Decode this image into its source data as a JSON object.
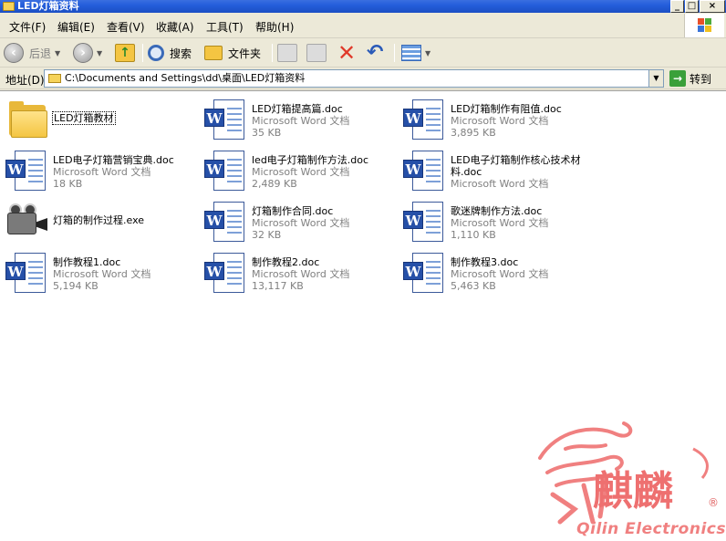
{
  "window": {
    "title": "LED灯箱资料",
    "controls": [
      "_",
      "□",
      "×"
    ]
  },
  "menu": [
    "文件(F)",
    "编辑(E)",
    "查看(V)",
    "收藏(A)",
    "工具(T)",
    "帮助(H)"
  ],
  "toolbar": {
    "back_label": "后退",
    "search_label": "搜索",
    "folders_label": "文件夹"
  },
  "address": {
    "label": "地址(D)",
    "path": "C:\\Documents and Settings\\dd\\桌面\\LED灯箱资料",
    "go_label": "转到"
  },
  "files": [
    {
      "name": "LED灯箱教材",
      "type": "",
      "size": "",
      "icon": "folder-icon"
    },
    {
      "name": "LED灯箱提高篇.doc",
      "type": "Microsoft Word 文档",
      "size": "35 KB",
      "icon": "word-doc-icon"
    },
    {
      "name": "LED灯箱制作有阻值.doc",
      "type": "Microsoft Word 文档",
      "size": "3,895 KB",
      "icon": "word-doc-icon"
    },
    {
      "name": "LED电子灯箱营销宝典.doc",
      "type": "Microsoft Word 文档",
      "size": "18 KB",
      "icon": "word-doc-icon"
    },
    {
      "name": "led电子灯箱制作方法.doc",
      "type": "Microsoft Word 文档",
      "size": "2,489 KB",
      "icon": "word-doc-icon"
    },
    {
      "name": "LED电子灯箱制作核心技术材料.doc",
      "type": "Microsoft Word 文档",
      "size": "",
      "icon": "word-doc-icon"
    },
    {
      "name": "灯箱的制作过程.exe",
      "type": "",
      "size": "",
      "icon": "video-camera-icon"
    },
    {
      "name": "灯箱制作合同.doc",
      "type": "Microsoft Word 文档",
      "size": "32 KB",
      "icon": "word-doc-icon"
    },
    {
      "name": "歌迷牌制作方法.doc",
      "type": "Microsoft Word 文档",
      "size": "1,110 KB",
      "icon": "word-doc-icon"
    },
    {
      "name": "制作教程1.doc",
      "type": "Microsoft Word 文档",
      "size": "5,194 KB",
      "icon": "word-doc-icon"
    },
    {
      "name": "制作教程2.doc",
      "type": "Microsoft Word 文档",
      "size": "13,117 KB",
      "icon": "word-doc-icon"
    },
    {
      "name": "制作教程3.doc",
      "type": "Microsoft Word 文档",
      "size": "5,463 KB",
      "icon": "word-doc-icon"
    }
  ],
  "watermark": {
    "glyphs": "麒麟",
    "text": "Qilin Electronics",
    "reg": "®"
  },
  "colors": {
    "titlebar": "#245edb",
    "accent_delete": "#e03a2a",
    "go_green": "#3aa03a",
    "watermark": "#f08080"
  }
}
